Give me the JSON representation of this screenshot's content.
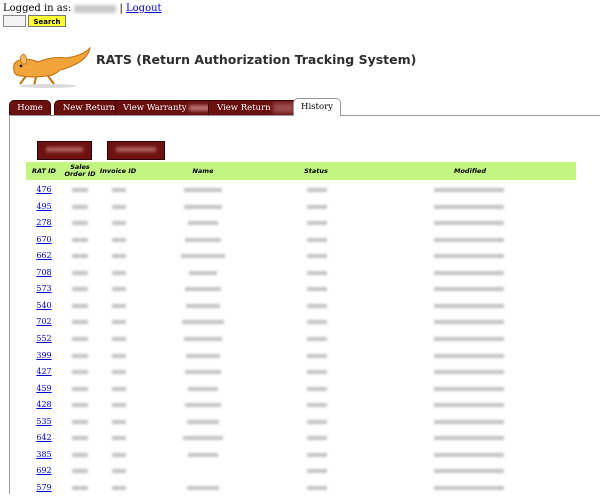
{
  "header": {
    "logged_in_prefix": "Logged in as:",
    "separator": "|",
    "logout_label": "Logout",
    "search_label": "Search"
  },
  "app": {
    "title": "RATS (Return Authorization Tracking System)"
  },
  "tabs": [
    {
      "label": "Home",
      "active": false
    },
    {
      "label": "New Return",
      "active": false
    },
    {
      "label": "View Warranty",
      "active": false
    },
    {
      "label": "View Return",
      "active": false
    },
    {
      "label": "History",
      "active": true
    }
  ],
  "table": {
    "columns": [
      "RAT ID",
      "Sales Order ID",
      "Invoice ID",
      "Name",
      "Status",
      "Modified"
    ],
    "rat_ids": [
      "476",
      "495",
      "278",
      "670",
      "662",
      "708",
      "573",
      "540",
      "702",
      "552",
      "399",
      "427",
      "459",
      "428",
      "535",
      "642",
      "385",
      "692",
      "579"
    ]
  },
  "colors": {
    "tab_bg": "#6b1010",
    "header_row_bg": "#c2f582",
    "search_button_bg": "#ffff33",
    "link": "#0000cc"
  }
}
